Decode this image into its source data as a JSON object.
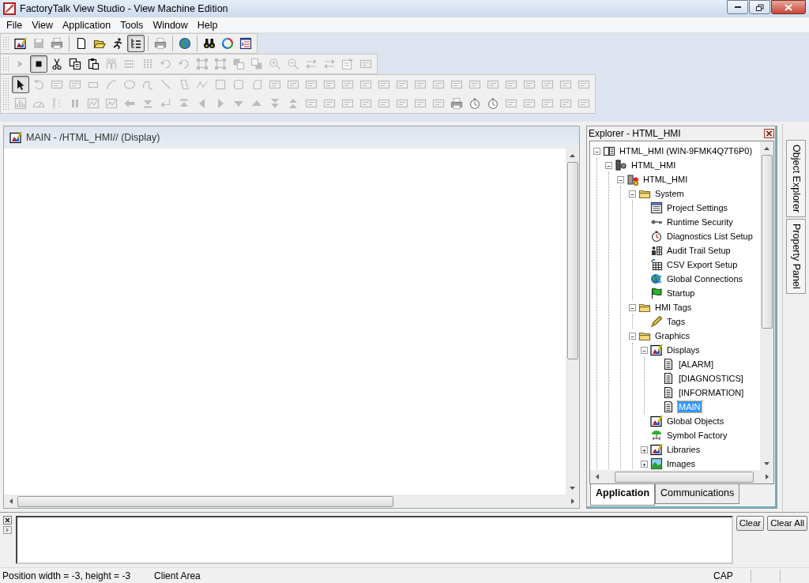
{
  "window": {
    "title": "FactoryTalk View Studio - View Machine Edition"
  },
  "menu": [
    "File",
    "View",
    "Application",
    "Tools",
    "Window",
    "Help"
  ],
  "toolbars": [
    {
      "rows": [
        [
          {
            "kind": "display",
            "disabled": false,
            "pressed": false
          },
          {
            "kind": "disk",
            "disabled": true,
            "pressed": false
          },
          {
            "kind": "printer",
            "disabled": true,
            "pressed": false
          },
          {
            "kind": "separator"
          },
          {
            "kind": "new-page",
            "disabled": false,
            "pressed": false
          },
          {
            "kind": "folder-open",
            "disabled": false,
            "pressed": false
          },
          {
            "kind": "runner",
            "disabled": false,
            "pressed": false
          },
          {
            "kind": "tree-list",
            "disabled": false,
            "pressed": true
          },
          {
            "kind": "separator"
          },
          {
            "kind": "printer",
            "disabled": true,
            "pressed": false
          },
          {
            "kind": "separator"
          },
          {
            "kind": "globe",
            "disabled": false,
            "pressed": false
          },
          {
            "kind": "separator"
          },
          {
            "kind": "binoculars",
            "disabled": false,
            "pressed": false
          },
          {
            "kind": "refresh",
            "disabled": false,
            "pressed": false
          },
          {
            "kind": "list-window",
            "disabled": false,
            "pressed": false
          }
        ]
      ]
    },
    {
      "rows": [
        [
          {
            "kind": "play",
            "disabled": true,
            "pressed": false
          },
          {
            "kind": "stop",
            "disabled": false,
            "pressed": true
          },
          {
            "kind": "scissors",
            "disabled": false,
            "pressed": false
          },
          {
            "kind": "copy",
            "disabled": false,
            "pressed": false
          },
          {
            "kind": "paste",
            "disabled": false,
            "pressed": false
          },
          {
            "kind": "people",
            "disabled": true,
            "pressed": false
          },
          {
            "kind": "dotted-rows",
            "disabled": true,
            "pressed": false
          },
          {
            "kind": "dotted-columns",
            "disabled": true,
            "pressed": false
          },
          {
            "kind": "rotate",
            "disabled": true,
            "pressed": false
          },
          {
            "kind": "rotate",
            "disabled": true,
            "pressed": false
          },
          {
            "kind": "resize-frame",
            "disabled": true,
            "pressed": false
          },
          {
            "kind": "resize-frame",
            "disabled": true,
            "pressed": false
          },
          {
            "kind": "bring-front",
            "disabled": true,
            "pressed": false
          },
          {
            "kind": "send-back",
            "disabled": true,
            "pressed": false
          },
          {
            "kind": "zoom-in",
            "disabled": true,
            "pressed": false
          },
          {
            "kind": "zoom-out",
            "disabled": true,
            "pressed": false
          },
          {
            "kind": "swap-arrows",
            "disabled": true,
            "pressed": false
          },
          {
            "kind": "swap-arrows",
            "disabled": true,
            "pressed": false
          },
          {
            "kind": "properties",
            "disabled": true,
            "pressed": false
          },
          {
            "kind": "panel",
            "disabled": true,
            "pressed": false
          }
        ]
      ]
    },
    {
      "rows": [
        [
          {
            "kind": "pointer",
            "disabled": false,
            "pressed": true
          },
          {
            "kind": "undo",
            "disabled": true,
            "pressed": false
          },
          {
            "kind": "panel",
            "disabled": true,
            "pressed": false
          },
          {
            "kind": "panel",
            "disabled": true,
            "pressed": false
          },
          {
            "kind": "rect-small",
            "disabled": true,
            "pressed": false
          },
          {
            "kind": "arc",
            "disabled": true,
            "pressed": false
          },
          {
            "kind": "ellipse",
            "disabled": true,
            "pressed": false
          },
          {
            "kind": "freehand",
            "disabled": true,
            "pressed": false
          },
          {
            "kind": "line",
            "disabled": true,
            "pressed": false
          },
          {
            "kind": "polygon",
            "disabled": true,
            "pressed": false
          },
          {
            "kind": "polyline",
            "disabled": true,
            "pressed": false
          },
          {
            "kind": "square",
            "disabled": true,
            "pressed": false
          },
          {
            "kind": "rounded-square",
            "disabled": true,
            "pressed": false
          },
          {
            "kind": "wedge",
            "disabled": true,
            "pressed": false
          },
          {
            "kind": "panel",
            "disabled": true,
            "pressed": false
          },
          {
            "kind": "panel",
            "disabled": true,
            "pressed": false
          },
          {
            "kind": "panel",
            "disabled": true,
            "pressed": false
          },
          {
            "kind": "panel",
            "disabled": true,
            "pressed": false
          },
          {
            "kind": "panel",
            "disabled": true,
            "pressed": false
          },
          {
            "kind": "panel",
            "disabled": true,
            "pressed": false
          },
          {
            "kind": "panel",
            "disabled": true,
            "pressed": false
          },
          {
            "kind": "panel",
            "disabled": true,
            "pressed": false
          },
          {
            "kind": "panel",
            "disabled": true,
            "pressed": false
          },
          {
            "kind": "panel",
            "disabled": true,
            "pressed": false
          },
          {
            "kind": "panel",
            "disabled": true,
            "pressed": false
          },
          {
            "kind": "panel",
            "disabled": true,
            "pressed": false
          },
          {
            "kind": "panel",
            "disabled": true,
            "pressed": false
          },
          {
            "kind": "panel",
            "disabled": true,
            "pressed": false
          },
          {
            "kind": "panel",
            "disabled": true,
            "pressed": false
          },
          {
            "kind": "panel",
            "disabled": true,
            "pressed": false
          },
          {
            "kind": "panel",
            "disabled": true,
            "pressed": false
          },
          {
            "kind": "panel",
            "disabled": true,
            "pressed": false
          }
        ],
        [
          {
            "kind": "bar-chart",
            "disabled": true,
            "pressed": false
          },
          {
            "kind": "gauge",
            "disabled": true,
            "pressed": false
          },
          {
            "kind": "scale",
            "disabled": true,
            "pressed": false
          },
          {
            "kind": "pause",
            "disabled": true,
            "pressed": false
          },
          {
            "kind": "trend",
            "disabled": true,
            "pressed": false
          },
          {
            "kind": "trend",
            "disabled": true,
            "pressed": false
          },
          {
            "kind": "left-arrow",
            "disabled": true,
            "pressed": false
          },
          {
            "kind": "down-end",
            "disabled": true,
            "pressed": false
          },
          {
            "kind": "enter",
            "disabled": true,
            "pressed": false
          },
          {
            "kind": "up-end",
            "disabled": true,
            "pressed": false
          },
          {
            "kind": "left-triangle",
            "disabled": true,
            "pressed": false
          },
          {
            "kind": "right-triangle",
            "disabled": true,
            "pressed": false
          },
          {
            "kind": "down-triangle",
            "disabled": true,
            "pressed": false
          },
          {
            "kind": "up-triangle",
            "disabled": true,
            "pressed": false
          },
          {
            "kind": "double-down",
            "disabled": true,
            "pressed": false
          },
          {
            "kind": "double-up",
            "disabled": true,
            "pressed": false
          },
          {
            "kind": "panel",
            "disabled": true,
            "pressed": false
          },
          {
            "kind": "panel",
            "disabled": true,
            "pressed": false
          },
          {
            "kind": "panel",
            "disabled": true,
            "pressed": false
          },
          {
            "kind": "panel",
            "disabled": true,
            "pressed": false
          },
          {
            "kind": "panel",
            "disabled": true,
            "pressed": false
          },
          {
            "kind": "panel",
            "disabled": true,
            "pressed": false
          },
          {
            "kind": "panel",
            "disabled": true,
            "pressed": false
          },
          {
            "kind": "panel",
            "disabled": true,
            "pressed": false
          },
          {
            "kind": "printer",
            "disabled": true,
            "pressed": false
          },
          {
            "kind": "stopwatch",
            "disabled": true,
            "pressed": false
          },
          {
            "kind": "stopwatch",
            "disabled": true,
            "pressed": false
          },
          {
            "kind": "panel",
            "disabled": true,
            "pressed": false
          },
          {
            "kind": "panel",
            "disabled": true,
            "pressed": false
          },
          {
            "kind": "panel",
            "disabled": true,
            "pressed": false
          },
          {
            "kind": "panel",
            "disabled": true,
            "pressed": false
          },
          {
            "kind": "panel",
            "disabled": true,
            "pressed": false
          }
        ]
      ]
    }
  ],
  "display_window": {
    "title": "MAIN - /HTML_HMI// (Display)"
  },
  "explorer": {
    "title": "Explorer - HTML_HMI",
    "tree": [
      {
        "label": "HTML_HMI (WIN-9FMK4Q7T6P0)",
        "kind": "book",
        "expanded": true,
        "selected": false,
        "children": [
          {
            "label": "HTML_HMI",
            "kind": "server",
            "expanded": true,
            "selected": false,
            "children": [
              {
                "label": "HTML_HMI",
                "kind": "alarm-server",
                "expanded": true,
                "selected": false,
                "children": [
                  {
                    "label": "System",
                    "kind": "folder",
                    "expanded": true,
                    "selected": false,
                    "children": [
                      {
                        "label": "Project Settings",
                        "kind": "settings-list",
                        "selected": false
                      },
                      {
                        "label": "Runtime Security",
                        "kind": "key",
                        "selected": false
                      },
                      {
                        "label": "Diagnostics List Setup",
                        "kind": "stopwatch",
                        "selected": false
                      },
                      {
                        "label": "Audit Trail Setup",
                        "kind": "audit",
                        "selected": false
                      },
                      {
                        "label": "CSV Export Setup",
                        "kind": "grid-table",
                        "selected": false
                      },
                      {
                        "label": "Global Connections",
                        "kind": "globe-arrows",
                        "selected": false
                      },
                      {
                        "label": "Startup",
                        "kind": "flag",
                        "selected": false
                      }
                    ]
                  },
                  {
                    "label": "HMI Tags",
                    "kind": "folder",
                    "expanded": true,
                    "selected": false,
                    "children": [
                      {
                        "label": "Tags",
                        "kind": "pencil",
                        "selected": false
                      }
                    ]
                  },
                  {
                    "label": "Graphics",
                    "kind": "folder",
                    "expanded": true,
                    "selected": false,
                    "children": [
                      {
                        "label": "Displays",
                        "kind": "display",
                        "expanded": true,
                        "selected": false,
                        "children": [
                          {
                            "label": "[ALARM]",
                            "kind": "document",
                            "selected": false
                          },
                          {
                            "label": "[DIAGNOSTICS]",
                            "kind": "document",
                            "selected": false
                          },
                          {
                            "label": "[INFORMATION]",
                            "kind": "document",
                            "selected": false
                          },
                          {
                            "label": "MAIN",
                            "kind": "document",
                            "selected": true
                          }
                        ]
                      },
                      {
                        "label": "Global Objects",
                        "kind": "display",
                        "selected": false
                      },
                      {
                        "label": "Symbol Factory",
                        "kind": "valve",
                        "selected": false
                      },
                      {
                        "label": "Libraries",
                        "kind": "display",
                        "expanded": false,
                        "selected": false
                      },
                      {
                        "label": "Images",
                        "kind": "image",
                        "expanded": false,
                        "selected": false
                      }
                    ]
                  }
                ]
              }
            ]
          }
        ]
      }
    ],
    "tabs": [
      {
        "label": "Application",
        "selected": true
      },
      {
        "label": "Communications",
        "selected": false
      }
    ]
  },
  "side_tabs": [
    "Object Explorer",
    "Property Panel"
  ],
  "output": {
    "buttons": [
      "Clear",
      "Clear All"
    ]
  },
  "status_bar": [
    "Position width = -3, height = -3",
    "Client Area",
    "CAP"
  ]
}
